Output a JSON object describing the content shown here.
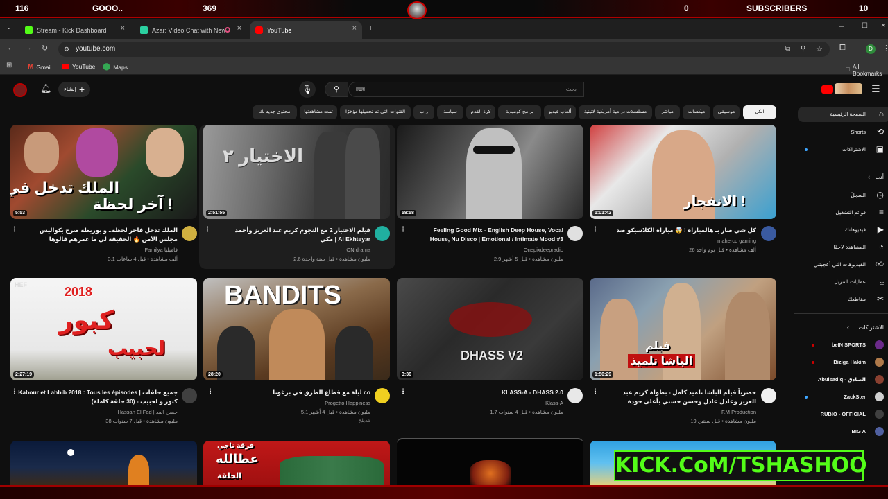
{
  "overlay": {
    "stat1": "116",
    "stat2": "GOOO..",
    "stat3": "369",
    "stat4": "0",
    "subscribers_label": "SUBSCRIBERS",
    "stat5": "10"
  },
  "tabs": [
    {
      "label": "Stream - Kick Dashboard",
      "color": "#53fc18"
    },
    {
      "label": "Azar: Video Chat with New",
      "color": "#2bd0a0"
    },
    {
      "label": "YouTube",
      "color": "#ff0000"
    }
  ],
  "address": {
    "url": "youtube.com"
  },
  "bookmarks": [
    {
      "label": "Gmail"
    },
    {
      "label": "YouTube"
    },
    {
      "label": "Maps"
    }
  ],
  "bookmarks_right": "All Bookmarks",
  "youtube": {
    "create_label": "إنشاء",
    "search_placeholder": "بحث"
  },
  "chips": [
    {
      "label": "الكل"
    },
    {
      "label": "موسيقى"
    },
    {
      "label": "ميكسات"
    },
    {
      "label": "مباشر"
    },
    {
      "label": "مسلسلات درامية أمريكية لاتينية"
    },
    {
      "label": "ألعاب فيديو"
    },
    {
      "label": "برامج كوميدية"
    },
    {
      "label": "كرة القدم"
    },
    {
      "label": "سياسة"
    },
    {
      "label": "راب"
    },
    {
      "label": "القنوات التي تم تحميلها مؤخرًا"
    },
    {
      "label": "تمت مشاهدتها"
    },
    {
      "label": "محتوى جديد لك"
    }
  ],
  "sidebar": {
    "items": [
      {
        "label": "الصفحة الرئيسية",
        "icon": "home-icon"
      },
      {
        "label": "Shorts",
        "icon": "shorts-icon"
      },
      {
        "label": "الاشتراكات",
        "icon": "subscriptions-icon"
      }
    ],
    "you_header": "أنت",
    "you_items": [
      {
        "label": "السجلّ",
        "icon": "history-icon"
      },
      {
        "label": "قوائم التشغيل",
        "icon": "playlists-icon"
      },
      {
        "label": "فيديوهاتك",
        "icon": "your-videos-icon"
      },
      {
        "label": "المشاهدة لاحقًا",
        "icon": "watch-later-icon"
      },
      {
        "label": "الفيديوهات التي أعجبتني",
        "icon": "liked-icon"
      },
      {
        "label": "عمليات التنزيل",
        "icon": "downloads-icon"
      },
      {
        "label": "مقاطعك",
        "icon": "clips-icon"
      }
    ],
    "subs_header": "الاشتراكات",
    "subs": [
      {
        "label": "beIN SPORTS",
        "color": "#6b2a8a"
      },
      {
        "label": "Biziga Hakim",
        "color": "#b07a4a"
      },
      {
        "label": "Abulsadiq - الصادق",
        "color": "#8a4030"
      },
      {
        "label": "ZackSter",
        "color": "#d0d0d0"
      },
      {
        "label": "RUBIO - OFFICIAL",
        "color": "#404040"
      },
      {
        "label": "BIG A",
        "color": "#5060a0"
      }
    ]
  },
  "videos": [
    {
      "title": "الملك تدخل فآخر لحظة.. و بوريطة صرح بكواليس مجلس الأمن 🔥 الحقيقة لي ما عمرهم قالوها فالإعلام!",
      "channel": "Familya فاميليا",
      "meta": "3.1 ألف مشاهدة • قبل 4 ساعات",
      "duration": "5:53",
      "overlay_text": "الملك تدخل في",
      "overlay_text2": "آخر لحظة !"
    },
    {
      "title": "فيلم الاختيار 2 مع النجوم كريم عبد العزيز وأحمد مكي | Al Ekhteyar",
      "channel": "ON drama",
      "meta": "2.6 مليون مشاهدة • قبل سنة واحدة",
      "duration": "2:51:55",
      "overlay_text": "الاختيار ٢"
    },
    {
      "title": "Feeling Good Mix - English Deep House, Vocal House, Nu Disco | Emotional / Intimate Mood #3",
      "channel": "Onepixdeepradio",
      "meta": "2.9 مليون مشاهدة • قبل 5 أشهر",
      "duration": "58:58"
    },
    {
      "title": "كل شي صار بـ هالمباراة ! 🤯 مباراة الكلاسيكو ضد إلياس المالكي ! 🔥",
      "channel": "maherco gaming",
      "meta": "26 ألف مشاهدة • قبل يوم واحد",
      "duration": "1:01:42",
      "overlay_text": "الانفجار !"
    },
    {
      "title": "Kabour et Lahbib 2018 : Tous les épisodes | جميع حلقات كبور و لحبيب - (30 حلقة كاملة)",
      "channel": "Hassan El Fad | حسن الفد",
      "meta": "38 مليون مشاهدة • قبل 7 سنوات",
      "duration": "2:27:19",
      "overlay_text": "كبور",
      "overlay_text2": "لحبيب",
      "overlay_year": "2018",
      "overlay_badge": "HEF"
    },
    {
      "title": "ليلة مع قطاع الطرق في برغوتا co",
      "channel": "Progetto Happiness",
      "meta": "5.1 مليون مشاهدة • قبل 4 أشهر",
      "extra": "مُدبلج",
      "duration": "28:20",
      "overlay_text": "BANDITS"
    },
    {
      "title": "KLASS-A - DHASS 2.0",
      "channel": "Klass-A",
      "meta": "1.7 مليون مشاهدة • قبل 4 سنوات",
      "duration": "3:36",
      "overlay_text": "DHASS V2"
    },
    {
      "title": "حصرياً فيلم الباشا تلميذ كامل - بطولة كريم عبد العزيز وعادل عادل وحسن حسني بأعلى جودة",
      "channel": "F.M Production",
      "meta": "19 مليون مشاهدة • قبل سنتين",
      "duration": "1:50:29",
      "overlay_text": "فيلم",
      "overlay_text2": "الباشا تلميذ"
    }
  ],
  "row3": [
    {
      "overlay_text": ""
    },
    {
      "overlay_text": "فرقة ناجي",
      "overlay_text2": "عطالله",
      "overlay_text3": "الحلقة"
    },
    {
      "overlay_text": ""
    },
    {
      "overlay_text": ""
    }
  ],
  "kick_banner": "KICK.CoM/TSHASHOO"
}
